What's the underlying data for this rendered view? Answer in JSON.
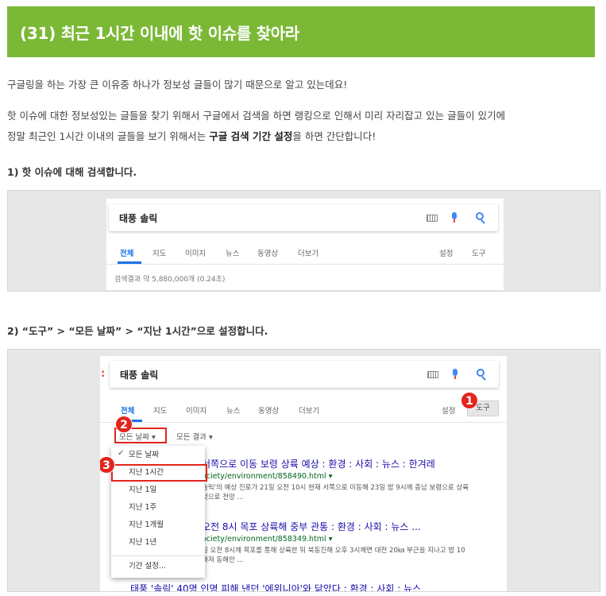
{
  "title": "(31) 최근 1시간 이내에 핫 이슈를 찾아라",
  "intro": "구글링을 하는 가장 큰 이유중 하나가 정보성 글들이 많기 때문으로 알고 있는데요!",
  "body_line1": "핫 이슈에 대한 정보성있는 글들을 찾기 위해서 구글에서 검색을 하면 랭킹으로 인해서 미리 자리잡고 있는 글들이 있기에",
  "body_line2_pre": "정말 최근인 1시간 이내의 글들을 보기 위해서는 ",
  "body_line2_bold": "구글 검색 기간 설정",
  "body_line2_post": "을 하면 간단합니다!",
  "step1": "1) 핫 이슈에 대해 검색합니다.",
  "step2": "2) “도구” > “모든 날짜” > “지난 1시간”으로 설정합니다.",
  "search": {
    "query": "태풍 솔릭",
    "tabs": [
      "전체",
      "지도",
      "이미지",
      "뉴스",
      "동영상",
      "더보기"
    ],
    "settings": "설정",
    "tools": "도구",
    "stats": "검색결과 약 5,880,000개 (0.24초)",
    "icons": [
      "keyboard-icon",
      "mic-icon",
      "search-icon"
    ]
  },
  "shot2": {
    "query": "태풍 솔릭",
    "tabs": [
      "전체",
      "지도",
      "이미지",
      "뉴스",
      "동영상",
      "더보기"
    ],
    "settings": "설정",
    "tools": "도구",
    "filter_date": "모든 날짜 ▾",
    "filter_result": "모든 결과 ▾",
    "menu": [
      "모든 날짜",
      "지난 1시간",
      "지난 1일",
      "지난 1주",
      "지난 1개월",
      "지난 1년",
      "기간 설정..."
    ],
    "menu_checked": "✓",
    "badges": [
      "1",
      "2",
      "3"
    ],
    "results": [
      {
        "title": "서쪽으로 이동 보령 상륙 예상 : 환경 : 사회 : 뉴스 : 한겨레",
        "url": "ociety/environment/858490.html ▾",
        "snip1": "솔릭'의 예상 진로가 21일 오전 10시 현재 서쪽으로 이동해 23일 밤 9시께 충남 보령으로 상륙",
        "snip2": "것으로 전망 ..."
      },
      {
        "title": "오전 8시 목포 상륙해 중부 관통 : 환경 : 사회 : 뉴스 ...",
        "url": "ociety/environment/858349.html ▾",
        "snip1": "일 오전 8시께 목포를 통해 상륙한 뒤 북동진해 오후 3시께면 대전 20㎞ 부근을 지나고 밤 10",
        "snip2": "빠져 동해안 ..."
      }
    ],
    "cut_title": "태풍 '솔릭' 40명 인명 피해 낸던 '에위니아'와 닮았다 : 환경 : 사회 : 뉴스"
  },
  "colors": {
    "banner": "#7bb836",
    "accent": "#1a73e8",
    "marker": "#e3251e"
  }
}
